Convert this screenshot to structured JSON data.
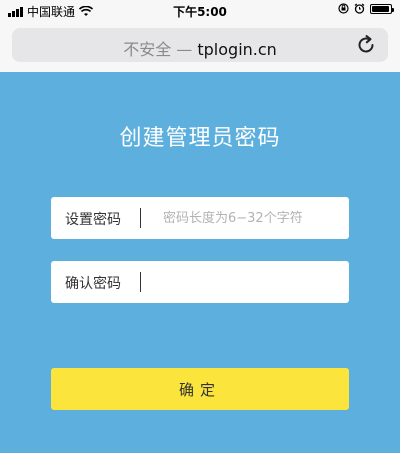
{
  "status_bar": {
    "carrier": "中国联通",
    "time": "下午5:00",
    "battery_level": 0.95
  },
  "browser": {
    "insecure_label": "不安全 —",
    "host": "tplogin.cn",
    "reload_icon": "reload-icon"
  },
  "page": {
    "title": "创建管理员密码",
    "background_color": "#5db0dd",
    "set_password": {
      "label": "设置密码",
      "value": "",
      "placeholder": "密码长度为6−32个字符"
    },
    "confirm_password": {
      "label": "确认密码",
      "value": "",
      "placeholder": ""
    },
    "confirm_button": {
      "label": "确定",
      "color": "#fbe43b"
    }
  }
}
